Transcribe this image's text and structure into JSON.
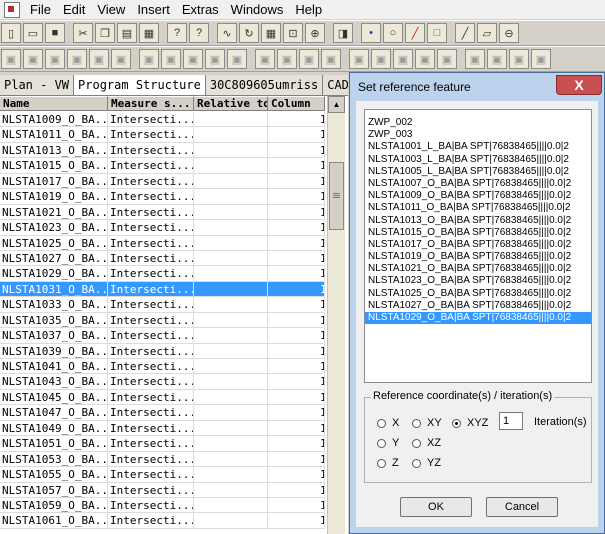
{
  "menubar": {
    "items": [
      "File",
      "Edit",
      "View",
      "Insert",
      "Extras",
      "Windows",
      "Help"
    ]
  },
  "toolbar1": {
    "icons": [
      "new-file-icon",
      "open-folder-icon",
      "save-icon",
      "cut-icon",
      "copy-icon",
      "paste-icon",
      "print-icon",
      "help-icon",
      "context-help-icon",
      "curve-icon",
      "rotate-icon",
      "grid-icon",
      "fit-icon",
      "zoom-icon",
      "shape-icon",
      "point-icon",
      "circle-icon",
      "line-icon",
      "square-icon",
      "straight-line-icon",
      "plane-icon",
      "cylinder-icon"
    ]
  },
  "toolbar2": {
    "icons": [
      "feature-1-icon",
      "feature-2-icon",
      "feature-3-icon",
      "feature-4-icon",
      "feature-5-icon",
      "feature-6-icon",
      "feature-7-icon",
      "feature-8-icon",
      "feature-9-icon",
      "feature-10-icon",
      "feature-11-icon",
      "feature-12-icon",
      "feature-13-icon",
      "feature-14-icon",
      "feature-15-icon",
      "feature-16-icon",
      "feature-17-icon",
      "feature-18-icon",
      "feature-19-icon",
      "feature-20-icon",
      "feature-21-icon",
      "feature-22-icon",
      "feature-23-icon",
      "feature-24-icon"
    ]
  },
  "left_panel": {
    "tabs": [
      "Plan - VW",
      "Program Structure",
      "30C809605umriss",
      "CAD mo"
    ],
    "columns": [
      "Name",
      "Measure s...",
      "Relative to",
      "Column"
    ],
    "rows": [
      {
        "name": "NLSTA1009_O_BA...",
        "measure": "Intersecti...",
        "relative": "",
        "column": "1"
      },
      {
        "name": "NLSTA1011_O_BA...",
        "measure": "Intersecti...",
        "relative": "",
        "column": "1"
      },
      {
        "name": "NLSTA1013_O_BA...",
        "measure": "Intersecti...",
        "relative": "",
        "column": "1"
      },
      {
        "name": "NLSTA1015_O_BA...",
        "measure": "Intersecti...",
        "relative": "",
        "column": "1"
      },
      {
        "name": "NLSTA1017_O_BA...",
        "measure": "Intersecti...",
        "relative": "",
        "column": "1"
      },
      {
        "name": "NLSTA1019_O_BA...",
        "measure": "Intersecti...",
        "relative": "",
        "column": "1"
      },
      {
        "name": "NLSTA1021_O_BA...",
        "measure": "Intersecti...",
        "relative": "",
        "column": "1"
      },
      {
        "name": "NLSTA1023_O_BA...",
        "measure": "Intersecti...",
        "relative": "",
        "column": "1"
      },
      {
        "name": "NLSTA1025_O_BA...",
        "measure": "Intersecti...",
        "relative": "",
        "column": "1"
      },
      {
        "name": "NLSTA1027_O_BA...",
        "measure": "Intersecti...",
        "relative": "",
        "column": "1"
      },
      {
        "name": "NLSTA1029_O_BA...",
        "measure": "Intersecti...",
        "relative": "",
        "column": "1"
      },
      {
        "name": "NLSTA1031_O_BA...",
        "measure": "Intersecti...",
        "relative": "",
        "column": "1",
        "selected": true
      },
      {
        "name": "NLSTA1033_O_BA...",
        "measure": "Intersecti...",
        "relative": "",
        "column": "1"
      },
      {
        "name": "NLSTA1035_O_BA...",
        "measure": "Intersecti...",
        "relative": "",
        "column": "1"
      },
      {
        "name": "NLSTA1037_O_BA...",
        "measure": "Intersecti...",
        "relative": "",
        "column": "1"
      },
      {
        "name": "NLSTA1039_O_BA...",
        "measure": "Intersecti...",
        "relative": "",
        "column": "1"
      },
      {
        "name": "NLSTA1041_O_BA...",
        "measure": "Intersecti...",
        "relative": "",
        "column": "1"
      },
      {
        "name": "NLSTA1043_O_BA...",
        "measure": "Intersecti...",
        "relative": "",
        "column": "1"
      },
      {
        "name": "NLSTA1045_O_BA...",
        "measure": "Intersecti...",
        "relative": "",
        "column": "1"
      },
      {
        "name": "NLSTA1047_O_BA...",
        "measure": "Intersecti...",
        "relative": "",
        "column": "1"
      },
      {
        "name": "NLSTA1049_O_BA...",
        "measure": "Intersecti...",
        "relative": "",
        "column": "1"
      },
      {
        "name": "NLSTA1051_O_BA...",
        "measure": "Intersecti...",
        "relative": "",
        "column": "1"
      },
      {
        "name": "NLSTA1053_O_BA...",
        "measure": "Intersecti...",
        "relative": "",
        "column": "1"
      },
      {
        "name": "NLSTA1055_O_BA...",
        "measure": "Intersecti...",
        "relative": "",
        "column": "1"
      },
      {
        "name": "NLSTA1057_O_BA...",
        "measure": "Intersecti...",
        "relative": "",
        "column": "1"
      },
      {
        "name": "NLSTA1059_O_BA...",
        "measure": "Intersecti...",
        "relative": "",
        "column": "1"
      },
      {
        "name": "NLSTA1061_O_BA...",
        "measure": "Intersecti...",
        "relative": "",
        "column": "1"
      }
    ]
  },
  "dialog": {
    "title": "Set reference feature",
    "close_label": "X",
    "list_items": [
      {
        "text": "ZWP_002"
      },
      {
        "text": "ZWP_003"
      },
      {
        "text": "NLSTA1001_L_BA|BA SPT|76838465||||0.0|2"
      },
      {
        "text": "NLSTA1003_L_BA|BA SPT|76838465||||0.0|2"
      },
      {
        "text": "NLSTA1005_L_BA|BA SPT|76838465||||0.0|2"
      },
      {
        "text": "NLSTA1007_O_BA|BA SPT|76838465||||0.0|2"
      },
      {
        "text": "NLSTA1009_O_BA|BA SPT|76838465||||0.0|2"
      },
      {
        "text": "NLSTA1011_O_BA|BA SPT|76838465||||0.0|2"
      },
      {
        "text": "NLSTA1013_O_BA|BA SPT|76838465||||0.0|2"
      },
      {
        "text": "NLSTA1015_O_BA|BA SPT|76838465||||0.0|2"
      },
      {
        "text": "NLSTA1017_O_BA|BA SPT|76838465||||0.0|2"
      },
      {
        "text": "NLSTA1019_O_BA|BA SPT|76838465||||0.0|2"
      },
      {
        "text": "NLSTA1021_O_BA|BA SPT|76838465||||0.0|2"
      },
      {
        "text": "NLSTA1023_O_BA|BA SPT|76838465||||0.0|2"
      },
      {
        "text": "NLSTA1025_O_BA|BA SPT|76838465||||0.0|2"
      },
      {
        "text": "NLSTA1027_O_BA|BA SPT|76838465||||0.0|2"
      },
      {
        "text": "NLSTA1029_O_BA|BA SPT|76838465||||0.0|2",
        "selected": true
      }
    ],
    "group_label": "Reference coordinate(s) / iteration(s)",
    "radios": [
      {
        "label": "X",
        "checked": false
      },
      {
        "label": "XY",
        "checked": false
      },
      {
        "label": "XYZ",
        "checked": true
      },
      {
        "label": "Y",
        "checked": false
      },
      {
        "label": "XZ",
        "checked": false
      },
      {
        "label": "Z",
        "checked": false
      },
      {
        "label": "YZ",
        "checked": false
      }
    ],
    "iteration_value": "1",
    "iteration_label": "Iteration(s)",
    "ok_label": "OK",
    "cancel_label": "Cancel"
  },
  "colors": {
    "selection": "#3399ff",
    "dialog_frame": "#bcd3ee",
    "close_button": "#c75050"
  }
}
